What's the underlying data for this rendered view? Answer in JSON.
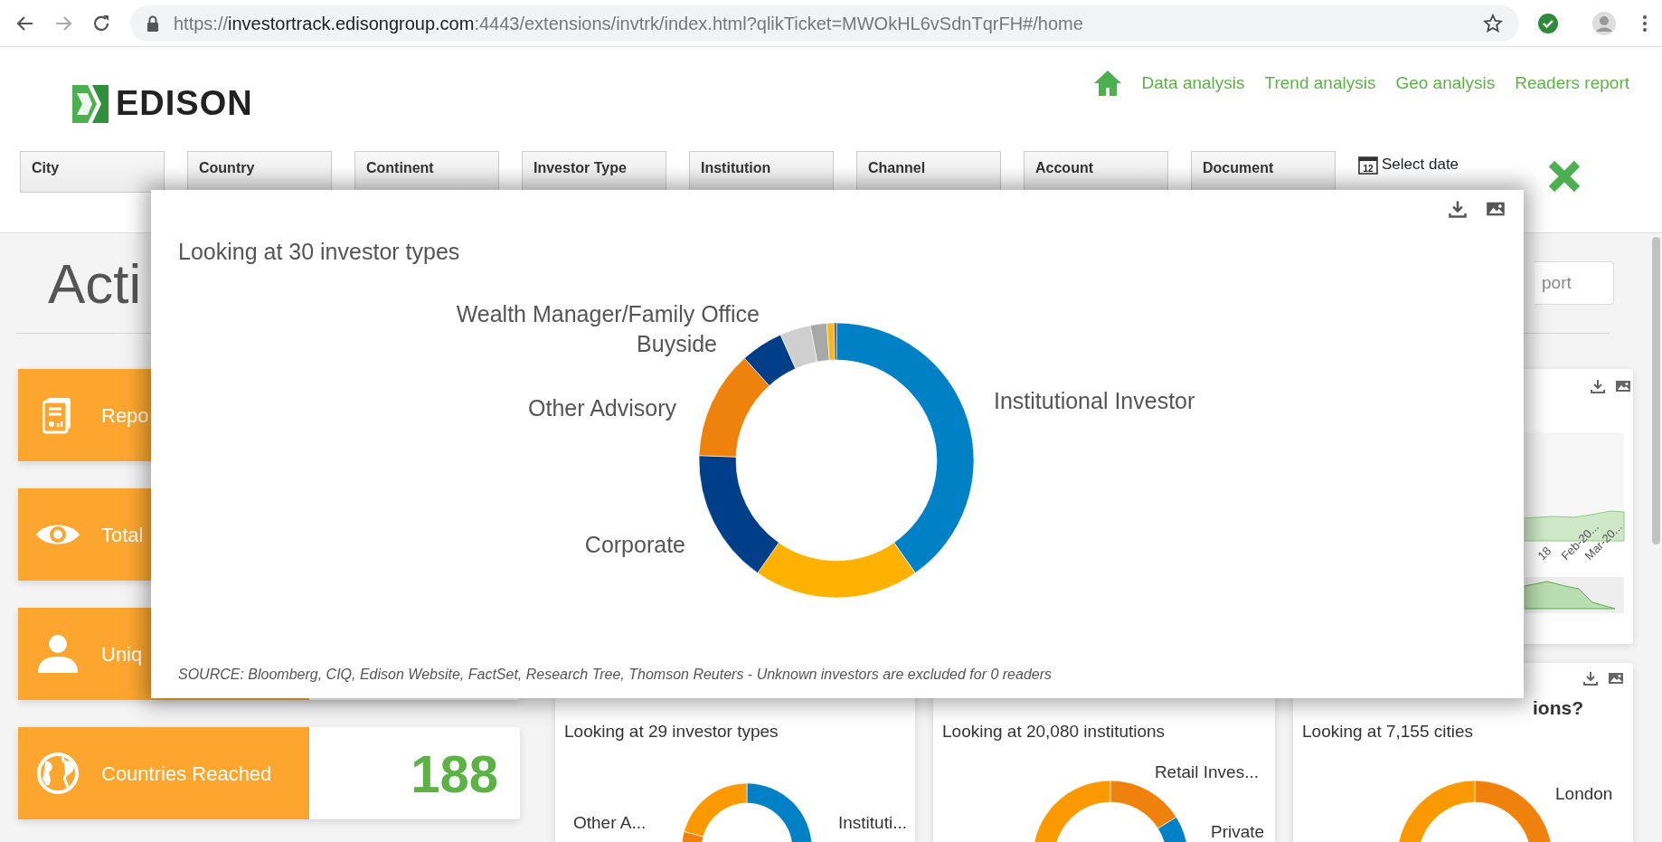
{
  "browser": {
    "url_scheme": "https://",
    "url_host": "investortrack.edisongroup.com",
    "url_path": ":4443/extensions/invtrk/index.html?qlikTicket=MWOkHL6vSdnTqrFH#/home"
  },
  "header": {
    "logo": "EDISON",
    "nav": [
      {
        "label": "Data analysis"
      },
      {
        "label": "Trend analysis"
      },
      {
        "label": "Geo analysis"
      },
      {
        "label": "Readers report"
      }
    ]
  },
  "filters": [
    {
      "label": "City"
    },
    {
      "label": "Country"
    },
    {
      "label": "Continent"
    },
    {
      "label": "Investor Type"
    },
    {
      "label": "Institution"
    },
    {
      "label": "Channel"
    },
    {
      "label": "Account"
    },
    {
      "label": "Document"
    }
  ],
  "date_filter": {
    "icon_text": "12",
    "label": "Select date"
  },
  "page_title": "Acti",
  "search": {
    "placeholder": "port"
  },
  "kpis": [
    {
      "kind": "report",
      "label": "Repo"
    },
    {
      "kind": "eye",
      "label": "Total"
    },
    {
      "kind": "user",
      "label": "Uniq"
    },
    {
      "kind": "globe",
      "label": "Countries Reached",
      "value": "188"
    }
  ],
  "trend_card": {
    "x_labels": [
      "18",
      "Feb-20...",
      "Mar-20..."
    ]
  },
  "bottom_cards": [
    {
      "subtitle": "Looking at 29 investor types",
      "labels": [
        "Other A...",
        "Instituti..."
      ]
    },
    {
      "subtitle": "Looking at 20,080 institutions",
      "labels": [
        "Retail Inves...",
        "Private"
      ]
    },
    {
      "title": "ions?",
      "subtitle": "Looking at 7,155 cities",
      "labels": [
        "London"
      ]
    }
  ],
  "modal": {
    "title": "Looking at 30 investor types",
    "labels": [
      "Wealth Manager/Family Office",
      "Buyside",
      "Other Advisory",
      "Corporate",
      "Institutional Investor"
    ],
    "source": "SOURCE: Bloomberg, CIQ, Edison Website, FactSet, Research Tree, Thomson Reuters - Unknown investors are excluded for 0 readers"
  }
}
